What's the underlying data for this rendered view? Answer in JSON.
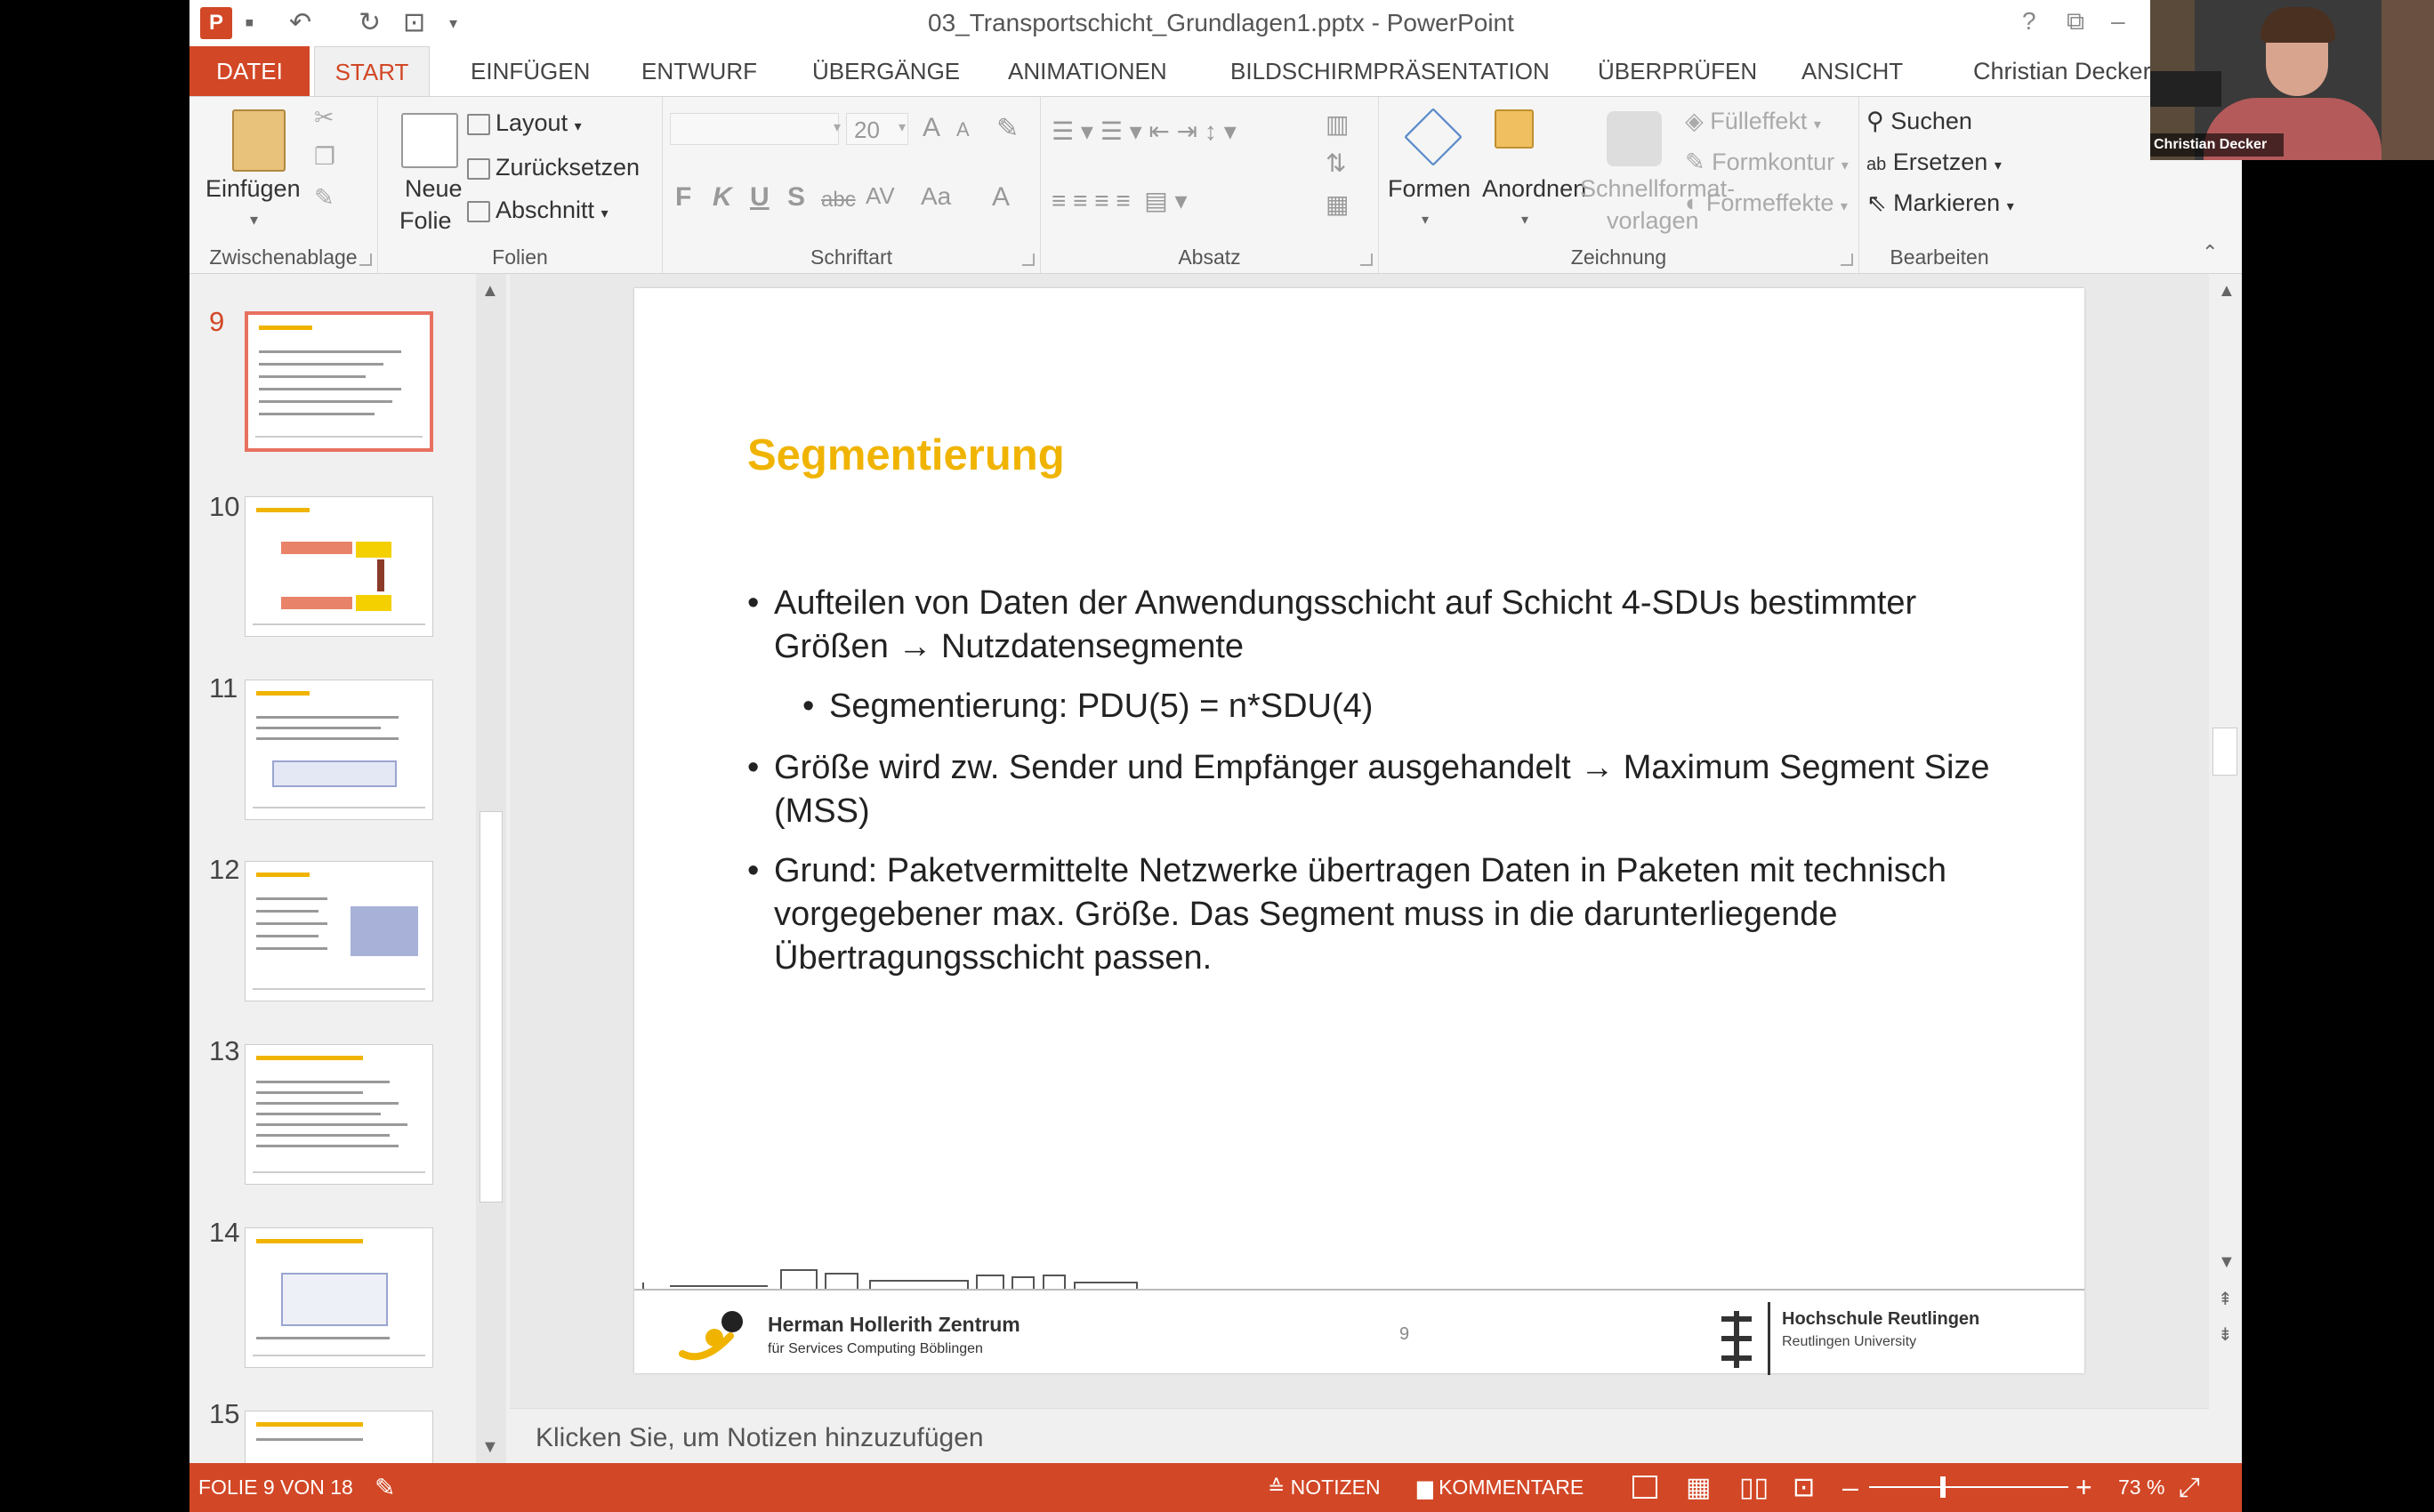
{
  "window": {
    "title": "03_Transportschicht_Grundlagen1.pptx - PowerPoint",
    "user": "Christian Decker",
    "help": "?"
  },
  "tabs": [
    "DATEI",
    "START",
    "EINFÜGEN",
    "ENTWURF",
    "ÜBERGÄNGE",
    "ANIMATIONEN",
    "BILDSCHIRMPRÄSENTATION",
    "ÜBERPRÜFEN",
    "ANSICHT"
  ],
  "ribbon": {
    "clipboard": {
      "paste": "Einfügen",
      "label": "Zwischenablage"
    },
    "slides": {
      "new_slide_1": "Neue",
      "new_slide_2": "Folie",
      "layout": "Layout",
      "reset": "Zurücksetzen",
      "section": "Abschnitt",
      "label": "Folien"
    },
    "font": {
      "size": "20",
      "label": "Schriftart",
      "bold": "F",
      "italic": "K",
      "underline": "U",
      "shadow": "S",
      "strike": "abc",
      "spacing": "AV",
      "case": "Aa",
      "color": "A",
      "grow": "A",
      "shrink": "A"
    },
    "paragraph": {
      "label": "Absatz"
    },
    "drawing": {
      "shapes": "Formen",
      "arrange": "Anordnen",
      "quickstyles_1": "Schnellformat-",
      "quickstyles_2": "vorlagen",
      "fill": "Fülleffekt",
      "outline": "Formkontur",
      "effects": "Formeffekte",
      "label": "Zeichnung"
    },
    "editing": {
      "find": "Suchen",
      "replace": "Ersetzen",
      "select": "Markieren",
      "label": "Bearbeiten"
    }
  },
  "thumbnails": [
    {
      "num": "9",
      "active": true
    },
    {
      "num": "10",
      "active": false
    },
    {
      "num": "11",
      "active": false
    },
    {
      "num": "12",
      "active": false
    },
    {
      "num": "13",
      "active": false
    },
    {
      "num": "14",
      "active": false
    },
    {
      "num": "15",
      "active": false
    }
  ],
  "slide": {
    "title": "Segmentierung",
    "bullets": [
      {
        "text": "Aufteilen von Daten der Anwendungsschicht auf Schicht 4-SDUs bestimmter Größen → Nutzdatensegmente",
        "sub": "Segmentierung: PDU(5) = n*SDU(4)"
      },
      {
        "text": "Größe wird zw. Sender und Empfänger ausgehandelt → Maximum Segment Size (MSS)"
      },
      {
        "text": "Grund: Paketvermittelte Netzwerke übertragen Daten in Paketen mit technisch vorgegebener max. Größe. Das Segment muss in die darunterliegende Übertragungsschicht passen."
      }
    ],
    "page_number": "9",
    "footer_left_title": "Herman Hollerith Zentrum",
    "footer_left_sub": "für Services Computing Böblingen",
    "footer_right_title": "Hochschule Reutlingen",
    "footer_right_sub": "Reutlingen University"
  },
  "notes_placeholder": "Klicken Sie, um Notizen hinzuzufügen",
  "status": {
    "slide_counter": "FOLIE 9 VON 18",
    "notes": "NOTIZEN",
    "comments": "KOMMENTARE",
    "zoom": "73 %",
    "zoom_level_percent": 73
  },
  "webcam": {
    "name": "Christian Decker"
  },
  "colors": {
    "accent": "#d24726",
    "title_yellow": "#f0b400"
  }
}
